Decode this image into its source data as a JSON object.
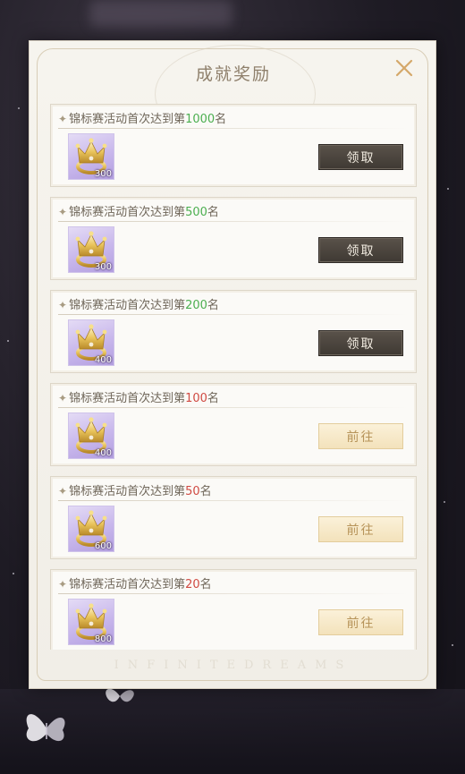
{
  "dialog": {
    "title": "成就奖励",
    "footer_text": "INFINITEDREAMS",
    "accent_color": "#b7945a"
  },
  "rewards": [
    {
      "prefix": "锦标赛活动首次达到第",
      "rank": "1000",
      "suffix": "名",
      "rank_color": "green",
      "item_icon": "gold-crown-icon",
      "quantity": "300",
      "button": "领取",
      "button_state": "claim"
    },
    {
      "prefix": "锦标赛活动首次达到第",
      "rank": "500",
      "suffix": "名",
      "rank_color": "green",
      "item_icon": "gold-crown-icon",
      "quantity": "300",
      "button": "领取",
      "button_state": "claim"
    },
    {
      "prefix": "锦标赛活动首次达到第",
      "rank": "200",
      "suffix": "名",
      "rank_color": "green",
      "item_icon": "gold-crown-icon",
      "quantity": "400",
      "button": "领取",
      "button_state": "claim"
    },
    {
      "prefix": "锦标赛活动首次达到第",
      "rank": "100",
      "suffix": "名",
      "rank_color": "red",
      "item_icon": "gold-crown-icon",
      "quantity": "400",
      "button": "前往",
      "button_state": "go"
    },
    {
      "prefix": "锦标赛活动首次达到第",
      "rank": "50",
      "suffix": "名",
      "rank_color": "red",
      "item_icon": "gold-crown-icon",
      "quantity": "600",
      "button": "前往",
      "button_state": "go"
    },
    {
      "prefix": "锦标赛活动首次达到第",
      "rank": "20",
      "suffix": "名",
      "rank_color": "red",
      "item_icon": "gold-crown-icon",
      "quantity": "800",
      "button": "前往",
      "button_state": "go"
    }
  ]
}
